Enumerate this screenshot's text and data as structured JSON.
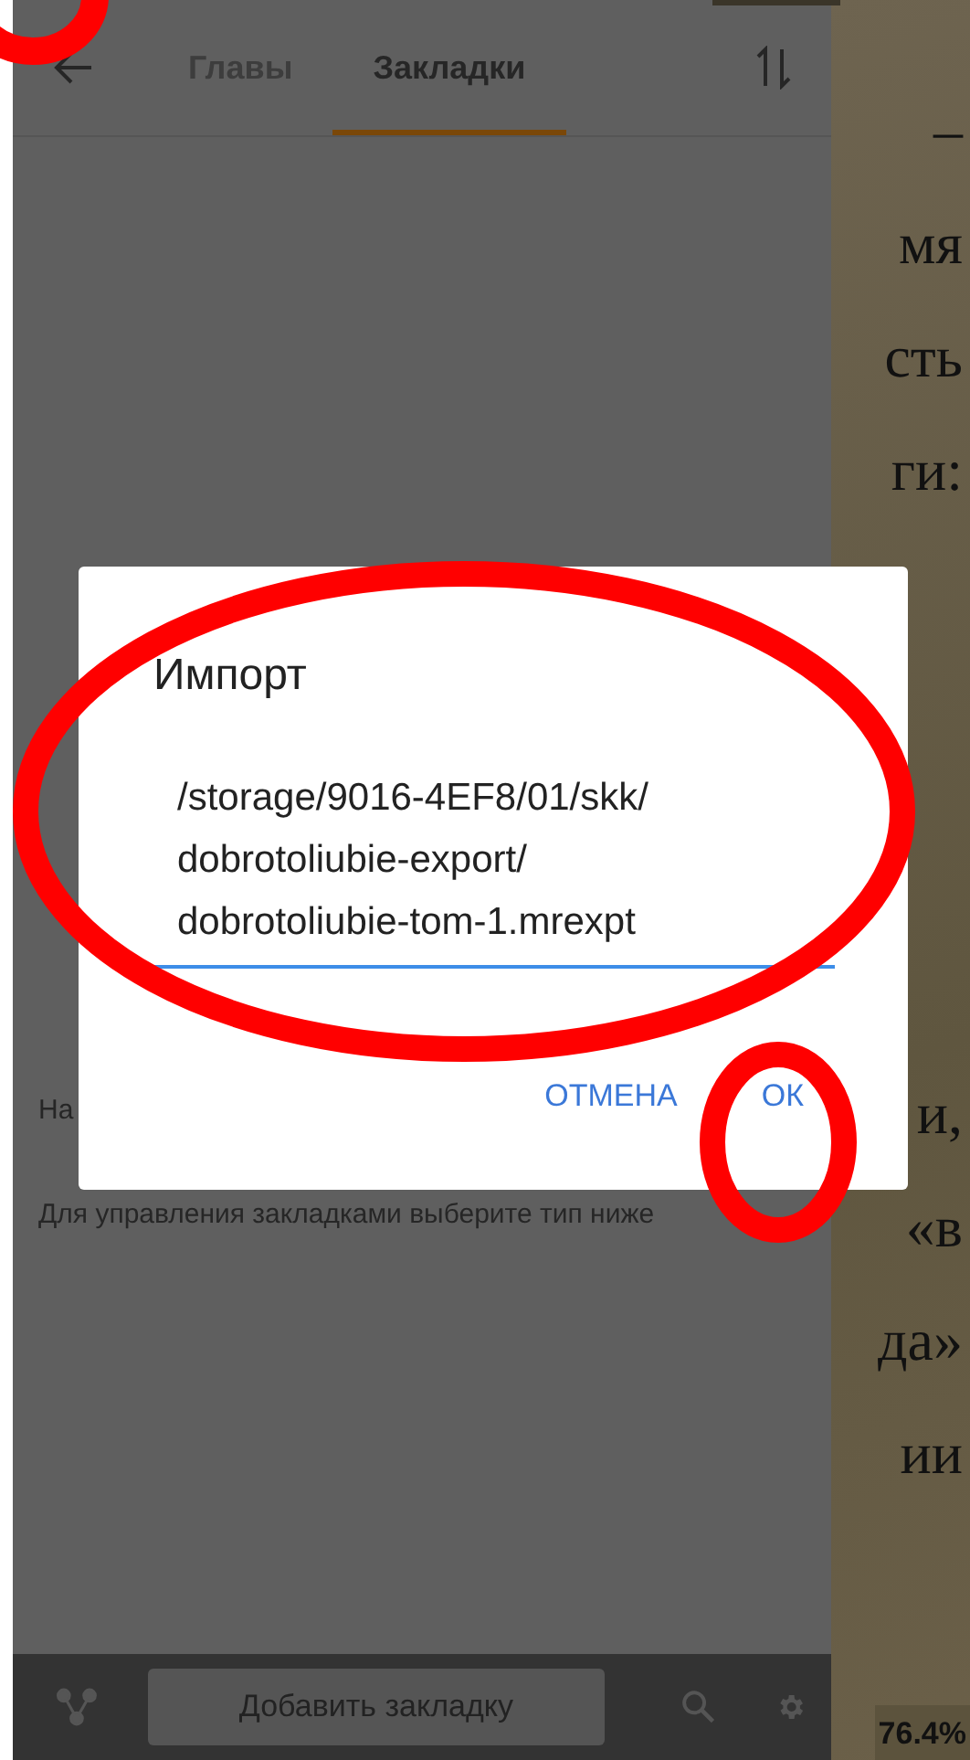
{
  "drawer": {
    "tabs": [
      {
        "label": "Главы",
        "selected": false
      },
      {
        "label": "Закладки",
        "selected": true
      }
    ],
    "hint_texts": [
      "На",
      "Для управления закладками выберите тип ниже"
    ],
    "bottom_bar": {
      "add_button": "Добавить закладку"
    }
  },
  "reader": {
    "lines_top": [
      "–",
      "мя",
      "сть",
      "ги:"
    ],
    "lines_bottom": [
      "и,",
      "«в",
      "да»",
      "ии"
    ],
    "progress": "76.4%"
  },
  "dialog": {
    "title": "Импорт",
    "value_lines": [
      "/storage/9016-4EF8/01/skk/",
      "dobrotoliubie-export/",
      "dobrotoliubie-tom-1.mrexpt"
    ],
    "buttons": [
      "ОТМЕНА",
      "ОК"
    ]
  }
}
